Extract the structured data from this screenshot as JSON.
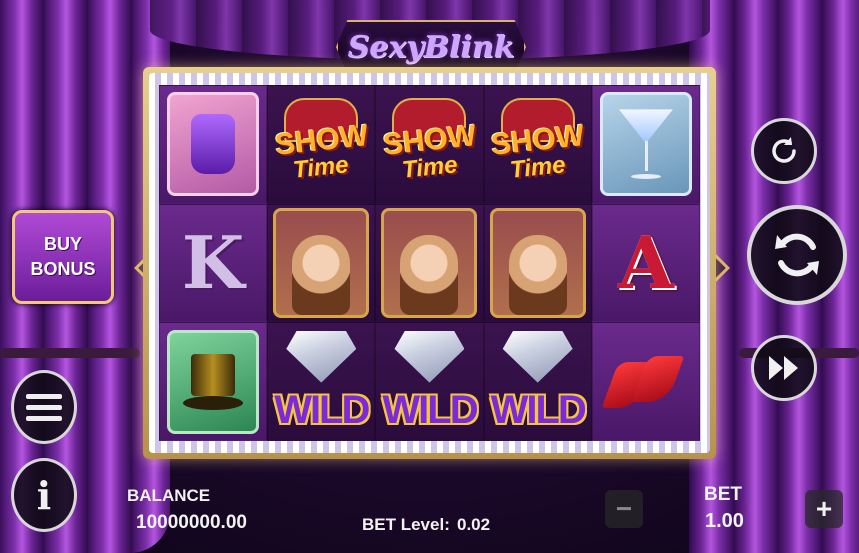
{
  "game": {
    "title": "SexyBlink"
  },
  "reels": {
    "columns": [
      [
        "perfume",
        "K",
        "top-hat"
      ],
      [
        "show-time",
        "portrait",
        "wild"
      ],
      [
        "show-time",
        "portrait",
        "wild"
      ],
      [
        "show-time",
        "portrait",
        "wild"
      ],
      [
        "cocktail",
        "A",
        "red-heels"
      ]
    ],
    "show_time_line1": "SHOW",
    "show_time_line2": "Time",
    "wild_label": "WILD",
    "letter_k": "K",
    "letter_a": "A"
  },
  "controls": {
    "buy_bonus_line1": "BUY",
    "buy_bonus_line2": "BONUS",
    "info_glyph": "i",
    "minus_glyph": "−",
    "plus_glyph": "+"
  },
  "footer": {
    "balance_label": "BALANCE",
    "balance_value": "10000000.00",
    "bet_level_label": "BET Level:",
    "bet_level_value": "0.02",
    "bet_label": "BET",
    "bet_value": "1.00"
  },
  "icons": [
    "replay-icon",
    "spin-icon",
    "fast-forward-icon",
    "menu-icon",
    "info-icon",
    "minus-icon",
    "plus-icon"
  ]
}
